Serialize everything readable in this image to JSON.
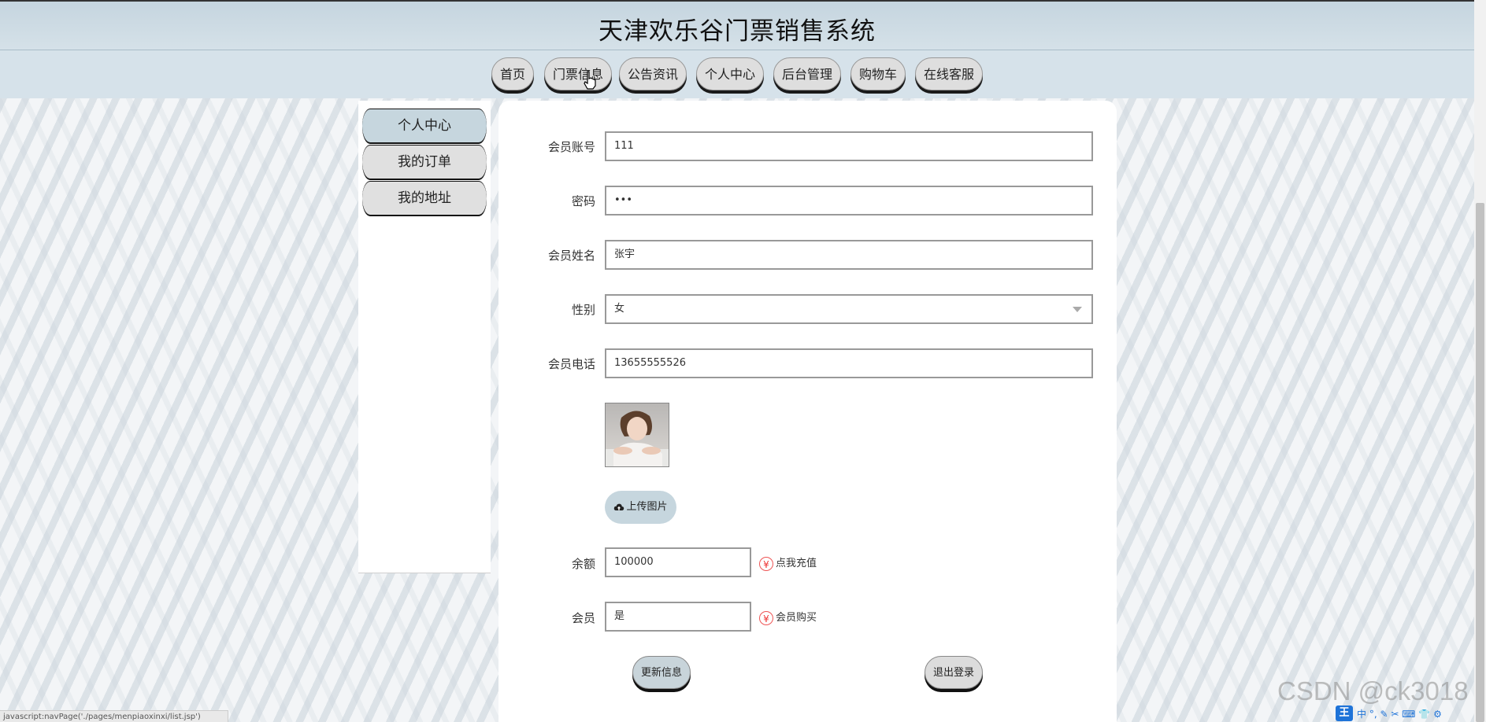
{
  "app": {
    "title": "天津欢乐谷门票销售系统"
  },
  "nav": {
    "items": [
      {
        "label": "首页"
      },
      {
        "label": "门票信息"
      },
      {
        "label": "公告资讯"
      },
      {
        "label": "个人中心"
      },
      {
        "label": "后台管理"
      },
      {
        "label": "购物车"
      },
      {
        "label": "在线客服"
      }
    ]
  },
  "sidebar": {
    "items": [
      {
        "label": "个人中心",
        "active": true
      },
      {
        "label": "我的订单",
        "active": false
      },
      {
        "label": "我的地址",
        "active": false
      }
    ]
  },
  "form": {
    "account": {
      "label": "会员账号",
      "value": "111"
    },
    "password": {
      "label": "密码",
      "value": "•••"
    },
    "name": {
      "label": "会员姓名",
      "value": "张宇"
    },
    "gender": {
      "label": "性别",
      "value": "女"
    },
    "phone": {
      "label": "会员电话",
      "value": "13655555526"
    },
    "upload_label": "上传图片",
    "balance": {
      "label": "余额",
      "value": "100000",
      "link": "点我充值"
    },
    "member": {
      "label": "会员",
      "value": "是",
      "link": "会员购买"
    },
    "update_label": "更新信息",
    "logout_label": "退出登录"
  },
  "icons": {
    "yen": "¥",
    "upload": "cloud-upload-icon"
  },
  "status_bar": {
    "text": "javascript:navPage('./pages/menpiaoxinxi/list.jsp')"
  },
  "watermark": "CSDN @ck3018",
  "ime": {
    "logo": "王",
    "symbols": "中 °, ✎ ✂ ⌨ 👕 ⚙"
  },
  "colors": {
    "header_bg": "#c5d5df",
    "accent": "#c6d6de",
    "button_gray": "#dedede",
    "yen_red": "#e33"
  }
}
